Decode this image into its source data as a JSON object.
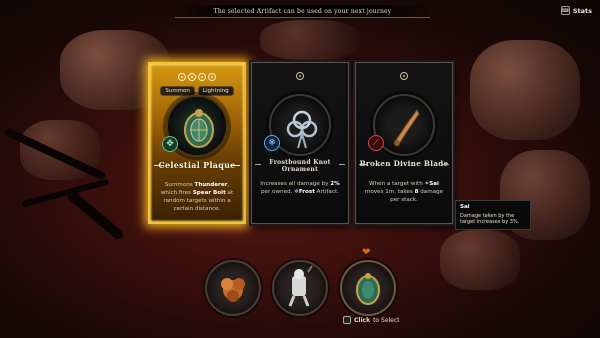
{
  "banner": {
    "text": "The selected Artifact can be used on your next journey"
  },
  "stats": {
    "label": "Stats"
  },
  "cards": [
    {
      "name": "Celestial Plaque",
      "tags": [
        "Summon",
        "Lightning"
      ],
      "tier_count": 4,
      "element_icon": "lightning-rune-icon",
      "selected": true,
      "desc_parts": [
        "Summons ",
        "Thunderer",
        ", which fires ",
        "Spear Bolt",
        " at random targets within a certain distance."
      ]
    },
    {
      "name": "Frostbound Knot Ornament",
      "tags": [],
      "tier_count": 1,
      "element_icon": "snowflake-icon",
      "selected": false,
      "desc_parts": [
        "Increases all damage by ",
        "2%",
        " per owned. ",
        "Frost",
        " Artifact."
      ]
    },
    {
      "name": "Broken Divine Blade",
      "tags": [],
      "tier_count": 1,
      "element_icon": "blood-slash-icon",
      "selected": false,
      "desc_parts": [
        "When a target with ",
        "Sai",
        " moves 1m, takes ",
        "8",
        " damage per stack."
      ]
    }
  ],
  "tooltip": {
    "title": "Sai",
    "body": "Damage taken by the target increases by 3%."
  },
  "owned_artifacts": [
    {
      "icon": "orange-blossom-icon"
    },
    {
      "icon": "bone-knight-icon"
    },
    {
      "icon": "celestial-plaque-icon"
    }
  ],
  "click_hint": {
    "click": "Click",
    "rest": " to Select"
  }
}
